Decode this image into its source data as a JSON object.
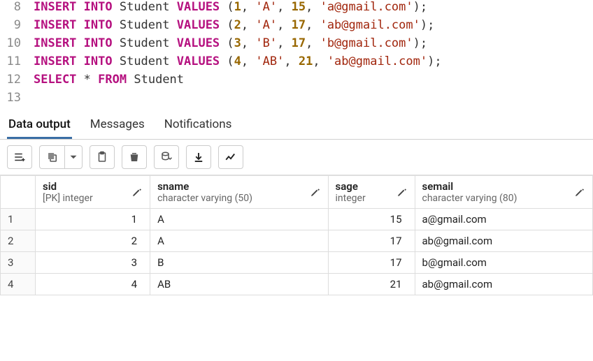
{
  "editor": {
    "lines": [
      {
        "num": 8,
        "tokens": [
          {
            "t": "kw",
            "v": "INSERT INTO"
          },
          {
            "t": "sp",
            "v": " "
          },
          {
            "t": "ident",
            "v": "Student"
          },
          {
            "t": "sp",
            "v": " "
          },
          {
            "t": "kw",
            "v": "VALUES"
          },
          {
            "t": "sp",
            "v": " "
          },
          {
            "t": "paren",
            "v": "("
          },
          {
            "t": "num",
            "v": "1"
          },
          {
            "t": "op",
            "v": ", "
          },
          {
            "t": "str",
            "v": "'A'"
          },
          {
            "t": "op",
            "v": ", "
          },
          {
            "t": "num",
            "v": "15"
          },
          {
            "t": "op",
            "v": ", "
          },
          {
            "t": "str",
            "v": "'a@gmail.com'"
          },
          {
            "t": "paren",
            "v": ")"
          },
          {
            "t": "op",
            "v": ";"
          }
        ]
      },
      {
        "num": 9,
        "tokens": [
          {
            "t": "kw",
            "v": "INSERT INTO"
          },
          {
            "t": "sp",
            "v": " "
          },
          {
            "t": "ident",
            "v": "Student"
          },
          {
            "t": "sp",
            "v": " "
          },
          {
            "t": "kw",
            "v": "VALUES"
          },
          {
            "t": "sp",
            "v": " "
          },
          {
            "t": "paren",
            "v": "("
          },
          {
            "t": "num",
            "v": "2"
          },
          {
            "t": "op",
            "v": ", "
          },
          {
            "t": "str",
            "v": "'A'"
          },
          {
            "t": "op",
            "v": ", "
          },
          {
            "t": "num",
            "v": "17"
          },
          {
            "t": "op",
            "v": ", "
          },
          {
            "t": "str",
            "v": "'ab@gmail.com'"
          },
          {
            "t": "paren",
            "v": ")"
          },
          {
            "t": "op",
            "v": ";"
          }
        ]
      },
      {
        "num": 10,
        "tokens": [
          {
            "t": "kw",
            "v": "INSERT INTO"
          },
          {
            "t": "sp",
            "v": " "
          },
          {
            "t": "ident",
            "v": "Student"
          },
          {
            "t": "sp",
            "v": " "
          },
          {
            "t": "kw",
            "v": "VALUES"
          },
          {
            "t": "sp",
            "v": " "
          },
          {
            "t": "paren",
            "v": "("
          },
          {
            "t": "num",
            "v": "3"
          },
          {
            "t": "op",
            "v": ", "
          },
          {
            "t": "str",
            "v": "'B'"
          },
          {
            "t": "op",
            "v": ", "
          },
          {
            "t": "num",
            "v": "17"
          },
          {
            "t": "op",
            "v": ", "
          },
          {
            "t": "str",
            "v": "'b@gmail.com'"
          },
          {
            "t": "paren",
            "v": ")"
          },
          {
            "t": "op",
            "v": ";"
          }
        ]
      },
      {
        "num": 11,
        "tokens": [
          {
            "t": "kw",
            "v": "INSERT INTO"
          },
          {
            "t": "sp",
            "v": " "
          },
          {
            "t": "ident",
            "v": "Student"
          },
          {
            "t": "sp",
            "v": " "
          },
          {
            "t": "kw",
            "v": "VALUES"
          },
          {
            "t": "sp",
            "v": " "
          },
          {
            "t": "paren",
            "v": "("
          },
          {
            "t": "num",
            "v": "4"
          },
          {
            "t": "op",
            "v": ", "
          },
          {
            "t": "str",
            "v": "'AB'"
          },
          {
            "t": "op",
            "v": ", "
          },
          {
            "t": "num",
            "v": "21"
          },
          {
            "t": "op",
            "v": ", "
          },
          {
            "t": "str",
            "v": "'ab@gmail.com'"
          },
          {
            "t": "paren",
            "v": ")"
          },
          {
            "t": "op",
            "v": ";"
          }
        ]
      },
      {
        "num": 12,
        "tokens": [
          {
            "t": "kw",
            "v": "SELECT"
          },
          {
            "t": "sp",
            "v": " "
          },
          {
            "t": "op",
            "v": "*"
          },
          {
            "t": "sp",
            "v": " "
          },
          {
            "t": "kw",
            "v": "FROM"
          },
          {
            "t": "sp",
            "v": " "
          },
          {
            "t": "ident",
            "v": "Student"
          }
        ]
      },
      {
        "num": 13,
        "tokens": []
      }
    ]
  },
  "tabs": {
    "data_output": "Data output",
    "messages": "Messages",
    "notifications": "Notifications"
  },
  "columns": [
    {
      "name": "sid",
      "type": "[PK] integer",
      "align": "num"
    },
    {
      "name": "sname",
      "type": "character varying (50)",
      "align": "text"
    },
    {
      "name": "sage",
      "type": "integer",
      "align": "num"
    },
    {
      "name": "semail",
      "type": "character varying (80)",
      "align": "text"
    }
  ],
  "rows": [
    {
      "n": 1,
      "cells": [
        "1",
        "A",
        "15",
        "a@gmail.com"
      ]
    },
    {
      "n": 2,
      "cells": [
        "2",
        "A",
        "17",
        "ab@gmail.com"
      ]
    },
    {
      "n": 3,
      "cells": [
        "3",
        "B",
        "17",
        "b@gmail.com"
      ]
    },
    {
      "n": 4,
      "cells": [
        "4",
        "AB",
        "21",
        "ab@gmail.com"
      ]
    }
  ]
}
